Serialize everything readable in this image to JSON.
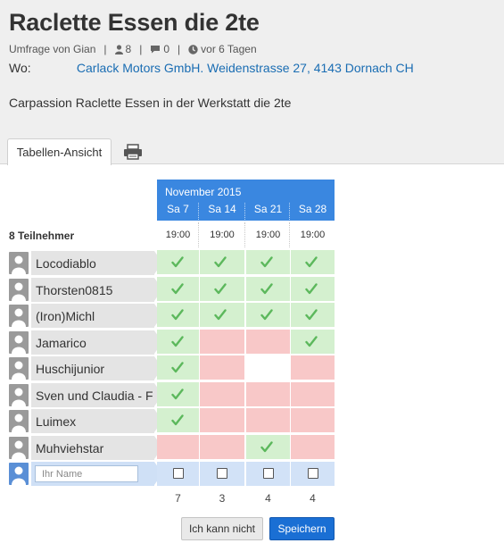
{
  "poll": {
    "title": "Raclette Essen die 2te",
    "meta": {
      "author": "Umfrage von Gian",
      "participants_count": "8",
      "comments_count": "0",
      "age": "vor 6 Tagen"
    },
    "where_label": "Wo:",
    "location": "Carlack Motors GmbH. Weidenstrasse 27, 4143 Dornach CH",
    "description": "Carpassion Raclette Essen in der Werkstatt die 2te"
  },
  "tabs": {
    "table_view": "Tabellen-Ansicht",
    "print_icon": "printer-icon"
  },
  "table": {
    "month": "November 2015",
    "participants_label": "8 Teilnehmer",
    "days": [
      {
        "label": "Sa 7",
        "time": "19:00",
        "total": "7"
      },
      {
        "label": "Sa 14",
        "time": "19:00",
        "total": "3"
      },
      {
        "label": "Sa 21",
        "time": "19:00",
        "total": "4"
      },
      {
        "label": "Sa 28",
        "time": "19:00",
        "total": "4"
      }
    ],
    "participants": [
      {
        "name": "Locodiablo",
        "votes": [
          "yes",
          "yes",
          "yes",
          "yes"
        ]
      },
      {
        "name": "Thorsten0815",
        "votes": [
          "yes",
          "yes",
          "yes",
          "yes"
        ]
      },
      {
        "name": "(Iron)Michl",
        "votes": [
          "yes",
          "yes",
          "yes",
          "yes"
        ]
      },
      {
        "name": "Jamarico",
        "votes": [
          "yes",
          "no",
          "no",
          "yes"
        ]
      },
      {
        "name": "Huschijunior",
        "votes": [
          "yes",
          "no",
          "empty",
          "no"
        ]
      },
      {
        "name": "Sven und Claudia - F",
        "votes": [
          "yes",
          "no",
          "no",
          "no"
        ]
      },
      {
        "name": "Luimex",
        "votes": [
          "yes",
          "no",
          "no",
          "no"
        ]
      },
      {
        "name": "Muhviehstar",
        "votes": [
          "no",
          "no",
          "yes",
          "no"
        ]
      }
    ],
    "new_entry": {
      "name_placeholder": "Ihr Name",
      "name_value": ""
    }
  },
  "actions": {
    "cannot_label": "Ich kann nicht",
    "save_label": "Speichern"
  },
  "colors": {
    "accent": "#3a87e0",
    "yes": "#d4f0cf",
    "no": "#f8c8c8",
    "check": "#5cb85c",
    "link": "#1a6db3",
    "save_button": "#1a6fd4"
  }
}
